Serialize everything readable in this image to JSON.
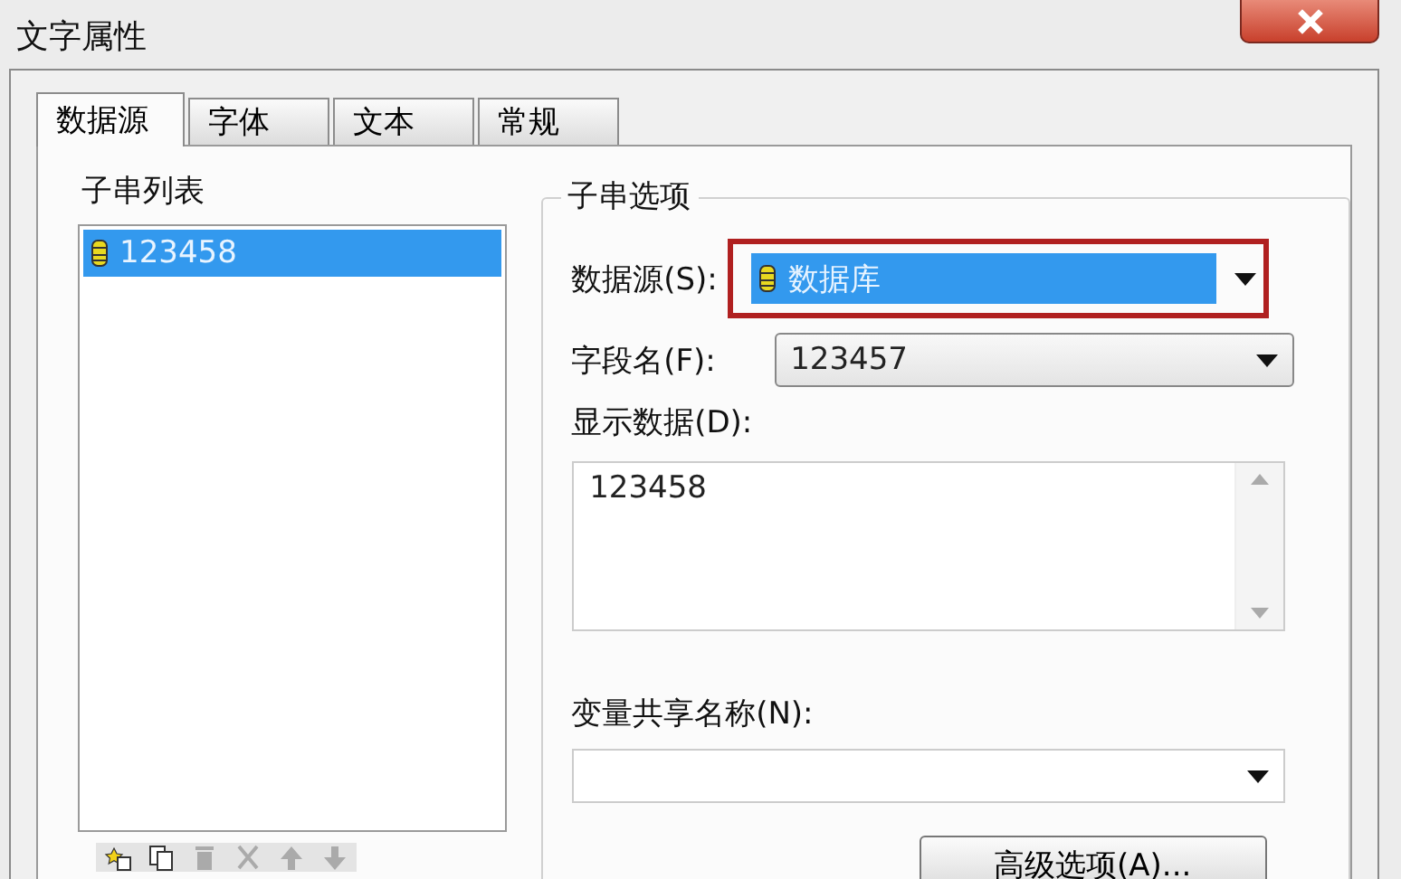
{
  "window": {
    "title": "文字属性"
  },
  "tabs": [
    {
      "label": "数据源",
      "selected": true
    },
    {
      "label": "字体",
      "selected": false
    },
    {
      "label": "文本",
      "selected": false
    },
    {
      "label": "常规",
      "selected": false
    }
  ],
  "substring_list": {
    "label": "子串列表",
    "items": [
      {
        "text": "123458",
        "selected": true
      }
    ],
    "toolbar": [
      {
        "kind": "new",
        "disabled": false
      },
      {
        "kind": "copy",
        "disabled": false
      },
      {
        "kind": "delete",
        "disabled": true
      },
      {
        "kind": "cut",
        "disabled": true
      },
      {
        "kind": "up",
        "disabled": true
      },
      {
        "kind": "down",
        "disabled": true
      }
    ]
  },
  "substring_options": {
    "label": "子串选项",
    "data_source": {
      "label": "数据源(S):",
      "value": "数据库",
      "highlighted": true
    },
    "field_name": {
      "label": "字段名(F):",
      "value": "123457"
    },
    "display_data": {
      "label": "显示数据(D):",
      "value": "123458"
    },
    "shared_name": {
      "label": "变量共享名称(N):"
    },
    "advanced_button": "高级选项(A)..."
  }
}
